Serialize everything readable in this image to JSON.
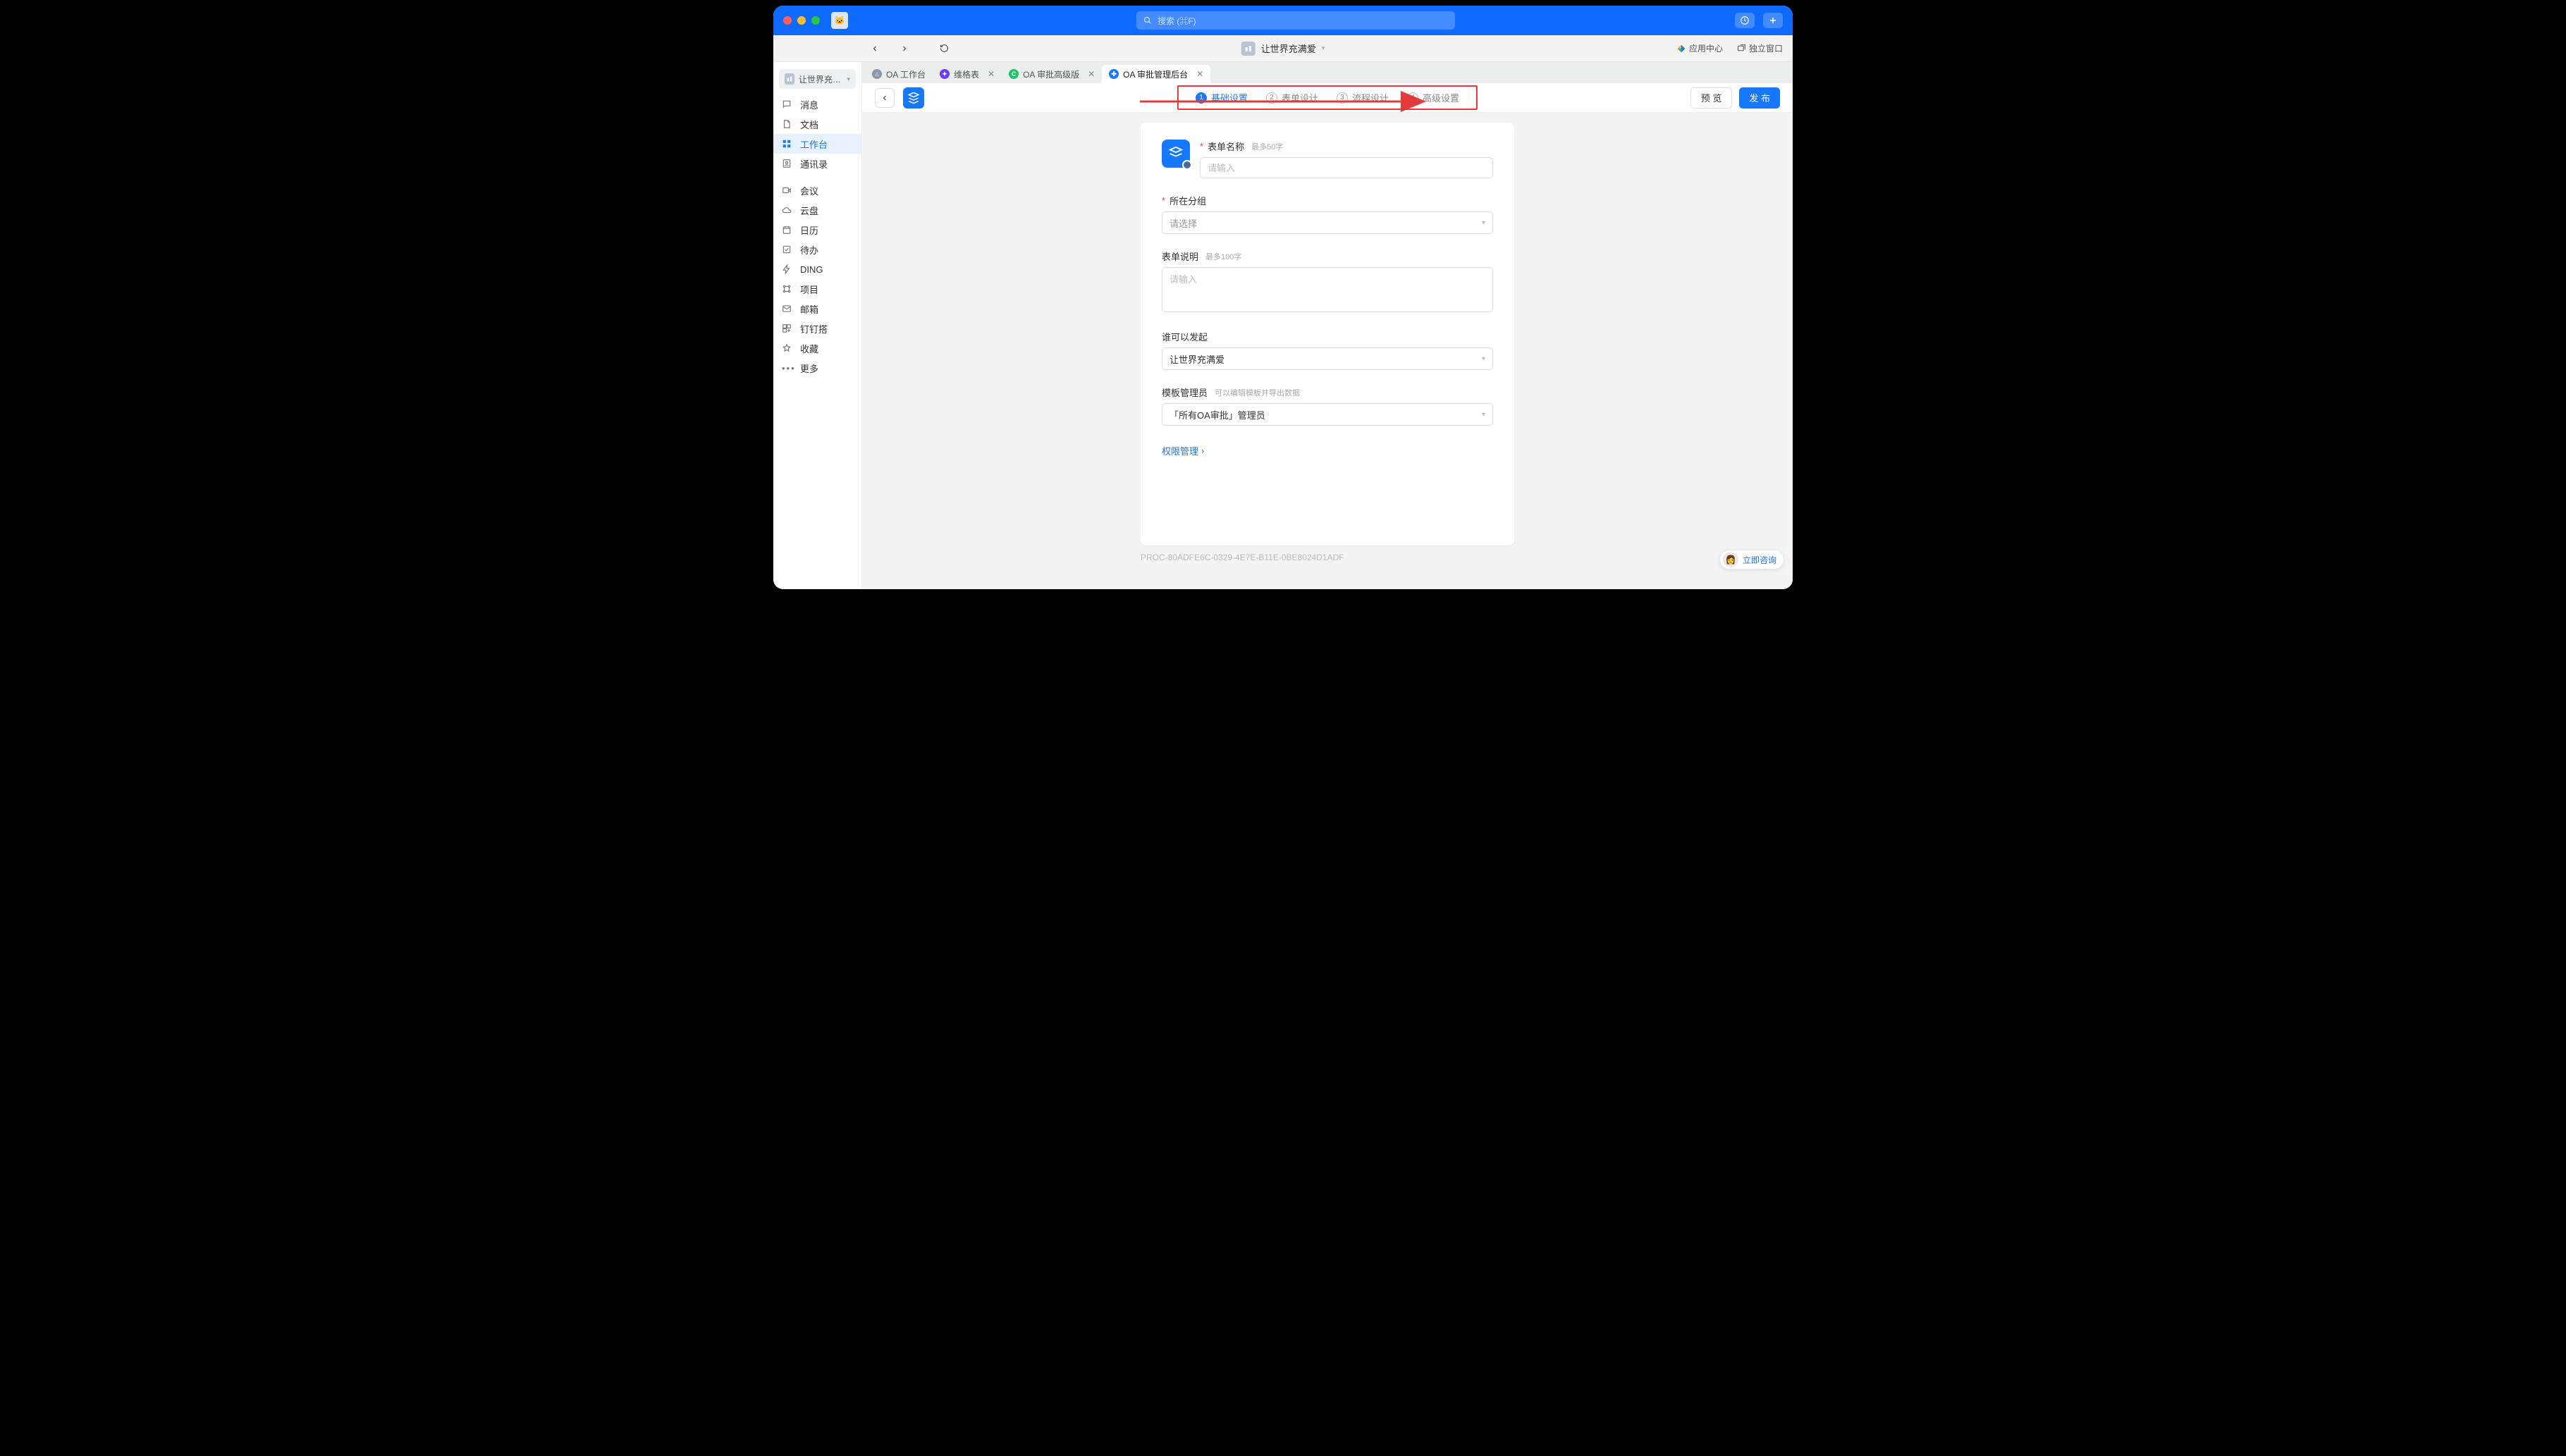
{
  "titlebar": {
    "search_placeholder": "搜索 (⌘F)"
  },
  "subheader": {
    "page_title": "让世界充满爱",
    "app_center": "应用中心",
    "detach_window": "独立窗口"
  },
  "sidebar": {
    "org_name": "让世界充满爱",
    "items": [
      {
        "icon": "chat-icon",
        "label": "消息"
      },
      {
        "icon": "doc-icon",
        "label": "文档"
      },
      {
        "icon": "grid-icon",
        "label": "工作台",
        "active": true
      },
      {
        "icon": "contacts-icon",
        "label": "通讯录"
      },
      {
        "icon": "meeting-icon",
        "label": "会议"
      },
      {
        "icon": "cloud-icon",
        "label": "云盘"
      },
      {
        "icon": "calendar-icon",
        "label": "日历"
      },
      {
        "icon": "todo-icon",
        "label": "待办"
      },
      {
        "icon": "ding-icon",
        "label": "DING"
      },
      {
        "icon": "project-icon",
        "label": "项目"
      },
      {
        "icon": "mail-icon",
        "label": "邮箱"
      },
      {
        "icon": "dingda-icon",
        "label": "钉钉搭"
      },
      {
        "icon": "star-icon",
        "label": "收藏"
      },
      {
        "icon": "more-icon",
        "label": "更多"
      }
    ]
  },
  "tabs": [
    {
      "icon_color": "#8a97ad",
      "glyph": "⌂",
      "label": "OA 工作台",
      "closable": false
    },
    {
      "icon_color": "#6a3df5",
      "glyph": "✦",
      "label": "维格表",
      "closable": true
    },
    {
      "icon_color": "#16c66a",
      "glyph": "C",
      "label": "OA 审批高级版",
      "closable": true
    },
    {
      "icon_color": "#1677ff",
      "glyph": "✚",
      "label": "OA 审批管理后台",
      "closable": true,
      "active": true
    }
  ],
  "steps": [
    {
      "num": "1",
      "label": "基础设置",
      "active": true
    },
    {
      "num": "2",
      "label": "表单设计"
    },
    {
      "num": "3",
      "label": "流程设计"
    },
    {
      "num": "4",
      "label": "高级设置"
    }
  ],
  "toolbar": {
    "preview": "预 览",
    "publish": "发 布"
  },
  "form": {
    "name_label": "表单名称",
    "name_hint": "最多50字",
    "name_placeholder": "请输入",
    "group_label": "所在分组",
    "group_placeholder": "请选择",
    "desc_label": "表单说明",
    "desc_hint": "最多100字",
    "desc_placeholder": "请输入",
    "who_label": "谁可以发起",
    "who_value": "让世界充满爱",
    "admin_label": "模板管理员",
    "admin_hint": "可以编辑模板并导出数据",
    "admin_value": "「所有OA审批」管理员",
    "perm_link": "权限管理"
  },
  "footer": {
    "proc_id": "PROC-80ADFE6C-0329-4E7E-B11E-0BE8024D1ADF"
  },
  "consult": {
    "label": "立即咨询"
  }
}
